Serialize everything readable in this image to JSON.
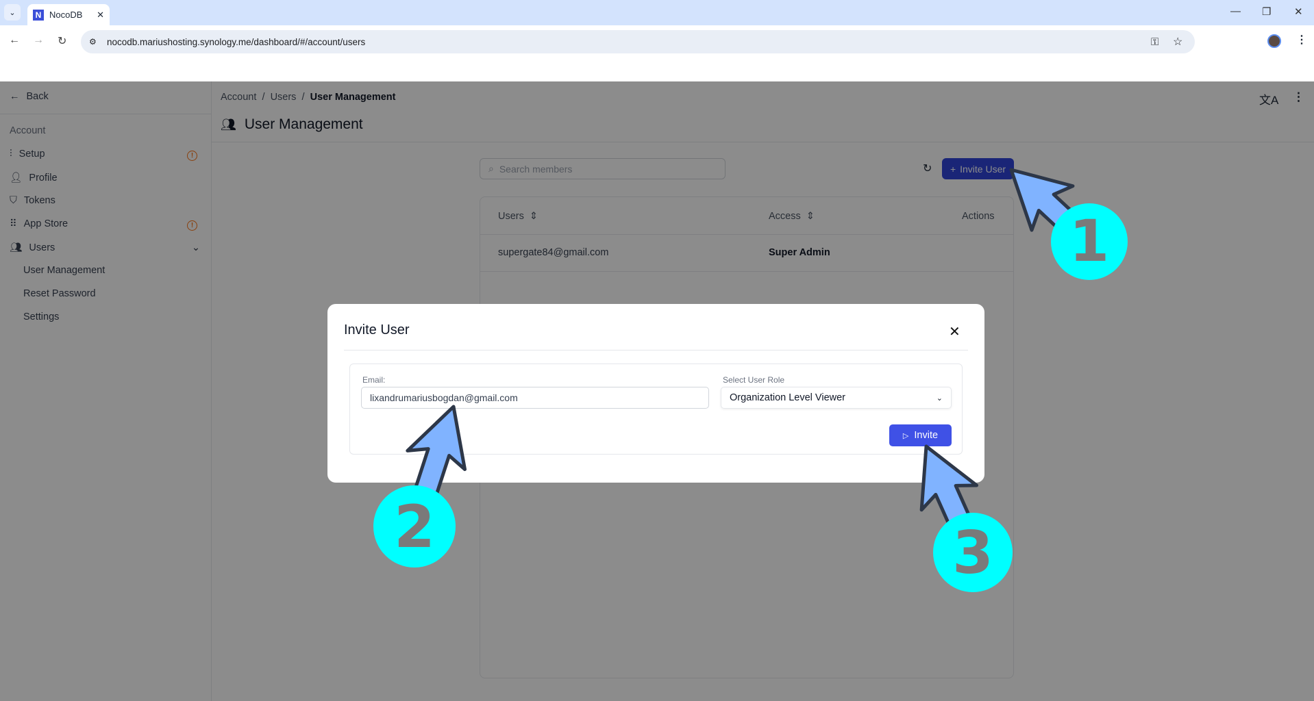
{
  "browser": {
    "tab_title": "NocoDB",
    "url": "nocodb.mariushosting.synology.me/dashboard/#/account/users"
  },
  "sidebar": {
    "back": "Back",
    "section": "Account",
    "items": [
      {
        "label": "Setup",
        "icon": "sliders-icon",
        "warning": true
      },
      {
        "label": "Profile",
        "icon": "user-icon"
      },
      {
        "label": "Tokens",
        "icon": "shield-icon"
      },
      {
        "label": "App Store",
        "icon": "grid-icon",
        "warning": true
      },
      {
        "label": "Users",
        "icon": "users-icon",
        "expanded": true
      }
    ],
    "subitems": [
      "User Management",
      "Reset Password",
      "Settings"
    ]
  },
  "breadcrumb": [
    "Account",
    "Users",
    "User Management"
  ],
  "page_title": "User Management",
  "search": {
    "placeholder": "Search members"
  },
  "invite_user_label": "Invite User",
  "table": {
    "headers": [
      "Users",
      "Access",
      "Actions"
    ],
    "rows": [
      {
        "user": "supergate84@gmail.com",
        "access": "Super Admin"
      }
    ]
  },
  "modal": {
    "title": "Invite User",
    "email_label": "Email:",
    "email_value": "lixandrumariusbogdan@gmail.com",
    "role_label": "Select User Role",
    "role_value": "Organization Level Viewer",
    "invite_label": "Invite"
  },
  "annotations": {
    "step1": "1",
    "step2": "2",
    "step3": "3",
    "circle_color": "#00ffff",
    "arrow_color": "#80b3ff"
  },
  "colors": {
    "primary": "#3044d9",
    "warning": "#f97316"
  }
}
